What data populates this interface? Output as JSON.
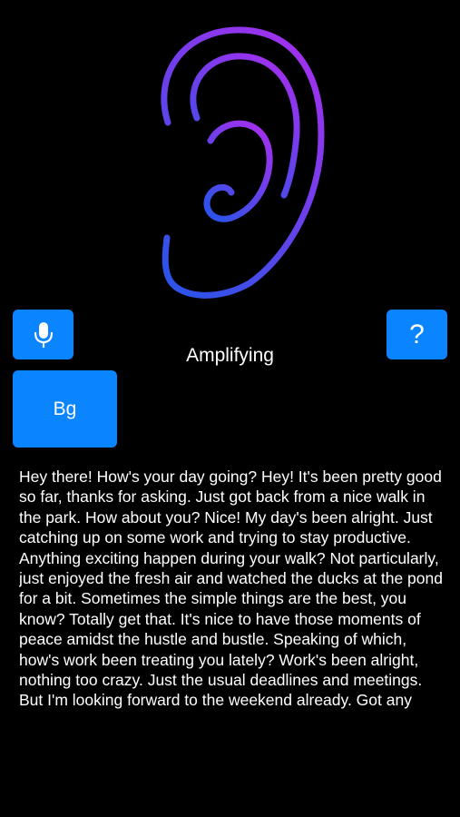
{
  "app": {
    "status_label": "Amplifying",
    "accent_color": "#0a84ff",
    "ear_gradient_top": "#a230ee",
    "ear_gradient_bottom": "#2f52e8"
  },
  "buttons": {
    "mic_icon": "microphone-icon",
    "help_label": "?",
    "bg_label": "Bg"
  },
  "transcript": {
    "text": "Hey there! How's your day going? Hey! It's been pretty good so far, thanks for asking. Just got back from a nice walk in the park. How about you? Nice! My day's been alright. Just catching up on some work and trying to stay productive. Anything exciting happen during your walk? Not particularly, just enjoyed the fresh air and watched the ducks at the pond for a bit. Sometimes the simple things are the best, you know? Totally get that. It's nice to have those moments of peace amidst the hustle and bustle. Speaking of which, how's work been treating you lately? Work's been alright, nothing too crazy. Just the usual deadlines and meetings. But I'm looking forward to the weekend already. Got any"
  }
}
